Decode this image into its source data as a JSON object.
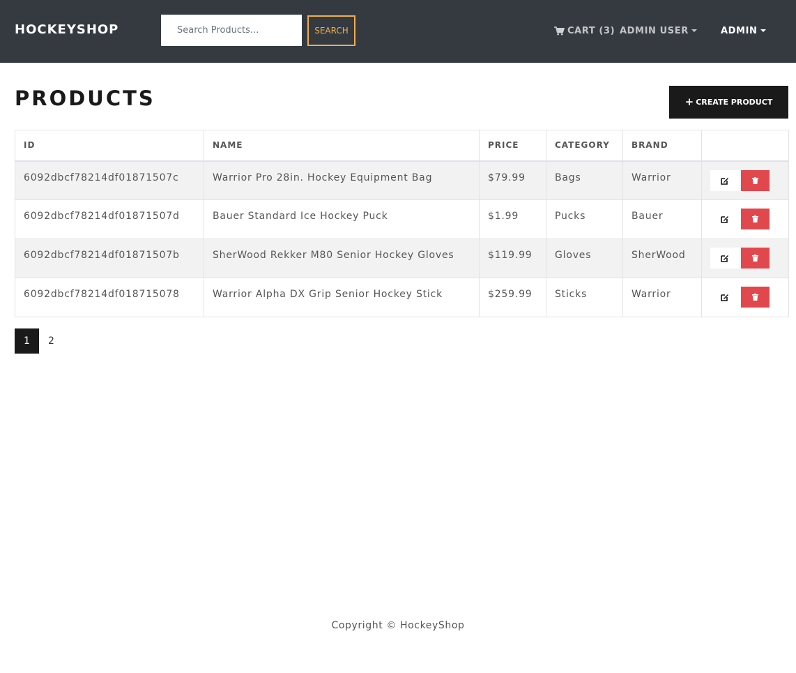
{
  "header": {
    "brand": "HOCKEYSHOP",
    "search": {
      "placeholder": "Search Products...",
      "value": "",
      "button_label": "SEARCH"
    },
    "cart_label": "CART (3)",
    "user_menu_label": "ADMIN USER",
    "admin_menu_label": "ADMIN"
  },
  "main": {
    "title": "PRODUCTS",
    "create_button_label": "CREATE PRODUCT",
    "table": {
      "columns": [
        "ID",
        "NAME",
        "PRICE",
        "CATEGORY",
        "BRAND",
        ""
      ],
      "rows": [
        {
          "id": "6092dbcf78214df01871507c",
          "name": "Warrior Pro 28in. Hockey Equipment Bag",
          "price": "$79.99",
          "category": "Bags",
          "brand": "Warrior"
        },
        {
          "id": "6092dbcf78214df01871507d",
          "name": "Bauer Standard Ice Hockey Puck",
          "price": "$1.99",
          "category": "Pucks",
          "brand": "Bauer"
        },
        {
          "id": "6092dbcf78214df01871507b",
          "name": "SherWood Rekker M80 Senior Hockey Gloves",
          "price": "$119.99",
          "category": "Gloves",
          "brand": "SherWood"
        },
        {
          "id": "6092dbcf78214df018715078",
          "name": "Warrior Alpha DX Grip Senior Hockey Stick",
          "price": "$259.99",
          "category": "Sticks",
          "brand": "Warrior"
        }
      ]
    },
    "pagination": {
      "pages": [
        "1",
        "2"
      ],
      "current": "1"
    }
  },
  "footer": {
    "copyright": "Copyright © HockeyShop"
  },
  "icons": {
    "cart": "shopping-cart-icon",
    "create": "plus-icon",
    "edit": "edit-icon",
    "delete": "trash-icon"
  },
  "colors": {
    "navbar": "#343a40",
    "search_accent": "#f0ad4e",
    "delete": "#e0484d",
    "dark": "#1a1a1a"
  }
}
